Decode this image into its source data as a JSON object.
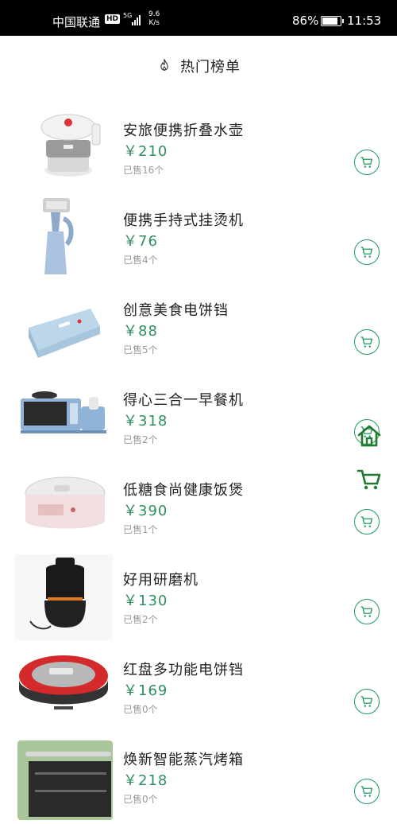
{
  "status_bar": {
    "carrier": "中国联通",
    "hd": "HD",
    "network": "5G",
    "speed_value": "9.6",
    "speed_unit": "K/s",
    "battery": "86%",
    "time": "11:53"
  },
  "header": {
    "title": "热门榜单",
    "icon": "fire-icon"
  },
  "products": [
    {
      "name": "安旅便携折叠水壶",
      "price": "￥210",
      "sold": "已售16个"
    },
    {
      "name": "便携手持式挂烫机",
      "price": "￥76",
      "sold": "已售4个"
    },
    {
      "name": "创意美食电饼铛",
      "price": "￥88",
      "sold": "已售5个"
    },
    {
      "name": "得心三合一早餐机",
      "price": "￥318",
      "sold": "已售2个"
    },
    {
      "name": "低糖食尚健康饭煲",
      "price": "￥390",
      "sold": "已售1个"
    },
    {
      "name": "好用研磨机",
      "price": "￥130",
      "sold": "已售2个"
    },
    {
      "name": "红盘多功能电饼铛",
      "price": "￥169",
      "sold": "已售0个"
    },
    {
      "name": "焕新智能蒸汽烤箱",
      "price": "￥218",
      "sold": "已售0个"
    }
  ],
  "floating": {
    "home_icon": "home-icon",
    "cart_icon": "shopping-cart-icon"
  },
  "colors": {
    "accent": "#1f9a5c",
    "price": "#2f8f62"
  }
}
